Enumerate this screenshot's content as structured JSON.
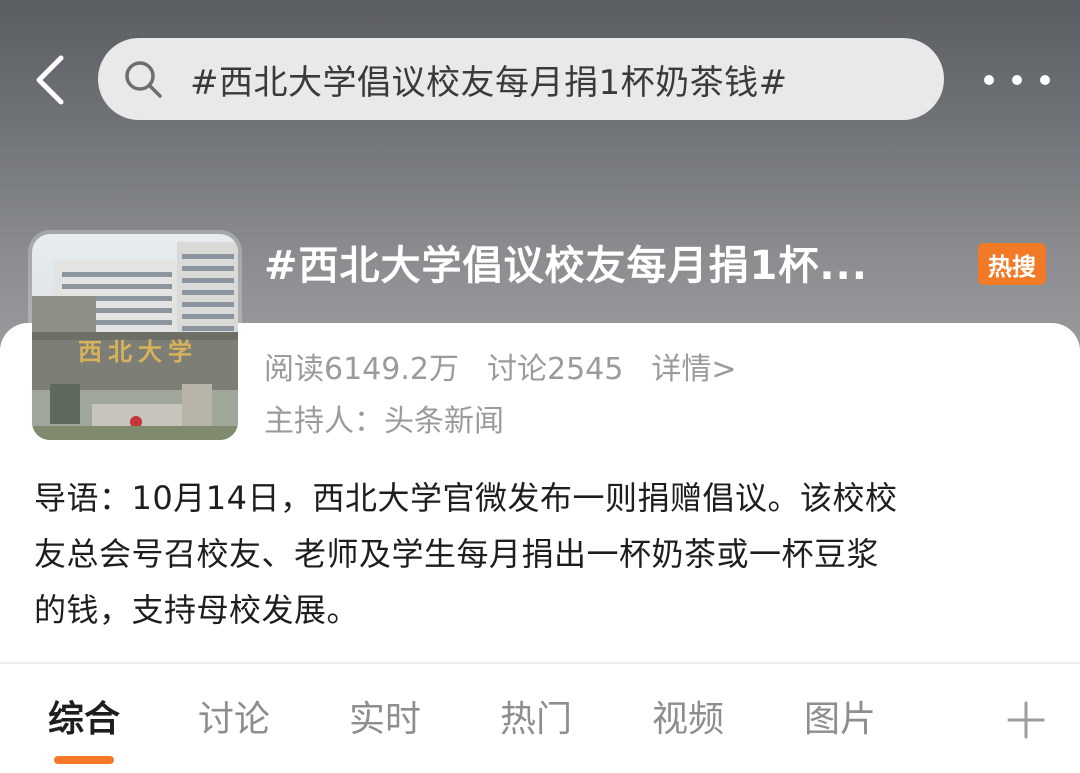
{
  "search": {
    "query": "#西北大学倡议校友每月捐1杯奶茶钱#"
  },
  "topic": {
    "title": "#西北大学倡议校友每月捐1杯...",
    "badge": "热搜",
    "thumb_sign": "西北大学",
    "stats": {
      "reads": "阅读6149.2万",
      "discussions": "讨论2545",
      "details": "详情>"
    },
    "host": "主持人：头条新闻"
  },
  "intro": {
    "lines": [
      "导语：10月14日，西北大学官微发布一则捐赠倡议。该校校",
      "友总会号召校友、老师及学生每月捐出一杯奶茶或一杯豆浆",
      "的钱，支持母校发展。"
    ]
  },
  "tabs": [
    "综合",
    "讨论",
    "实时",
    "热门",
    "视频",
    "图片"
  ],
  "active_tab": "综合",
  "colors": {
    "accent": "#f27a26",
    "header_bg": "#707377"
  }
}
